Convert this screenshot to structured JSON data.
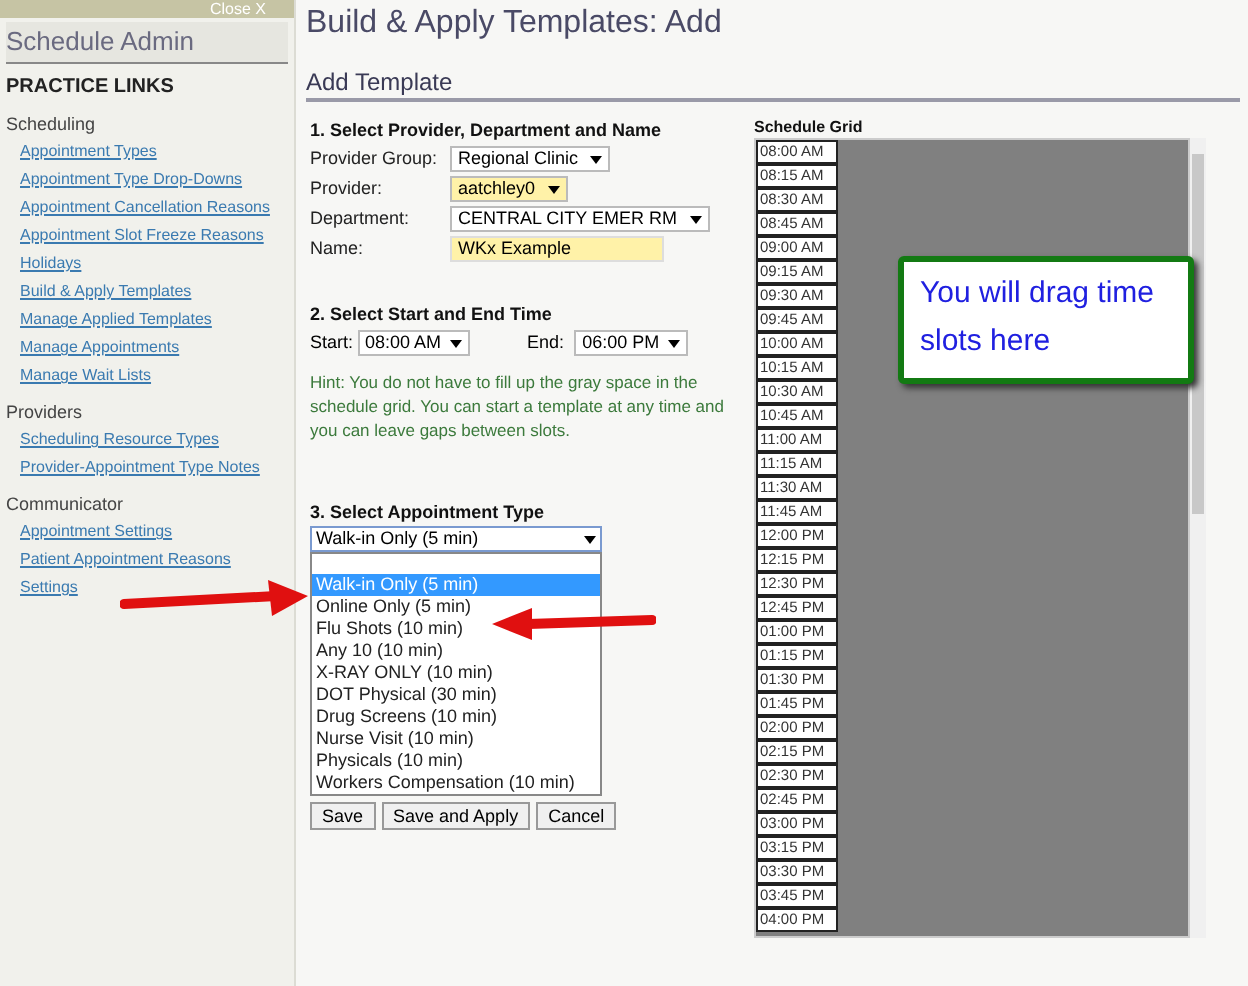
{
  "sidebar": {
    "close_label": "Close X",
    "title": "Schedule Admin",
    "heading": "PRACTICE LINKS",
    "groups": [
      {
        "label": "Scheduling",
        "links": [
          "Appointment Types",
          "Appointment Type Drop-Downs",
          "Appointment Cancellation Reasons",
          "Appointment Slot Freeze Reasons",
          "Holidays",
          "Build & Apply Templates",
          "Manage Applied Templates",
          "Manage Appointments",
          "Manage Wait Lists"
        ]
      },
      {
        "label": "Providers",
        "links": [
          "Scheduling Resource Types",
          "Provider-Appointment Type Notes"
        ]
      },
      {
        "label": "Communicator",
        "links": [
          "Appointment Settings",
          "Patient Appointment Reasons Settings"
        ]
      }
    ]
  },
  "page_title": "Build & Apply Templates: Add",
  "section_title": "Add Template",
  "step1": {
    "heading": "1. Select Provider, Department and Name",
    "fields": [
      {
        "label": "Provider Group:",
        "value": "Regional Clinic",
        "kind": "select",
        "required": false
      },
      {
        "label": "Provider:",
        "value": "aatchley0",
        "kind": "select",
        "required": true
      },
      {
        "label": "Department:",
        "value": "CENTRAL CITY EMER RM",
        "kind": "select",
        "required": false
      },
      {
        "label": "Name:",
        "value": "WKx Example",
        "kind": "text",
        "required": true
      }
    ]
  },
  "step2": {
    "heading": "2. Select Start and End Time",
    "start_label": "Start:",
    "start_value": "08:00 AM",
    "end_label": "End:",
    "end_value": "06:00 PM"
  },
  "hint": "Hint: You do not have to fill up the gray space in the schedule grid. You can start a template at any time and you can leave gaps between slots.",
  "step3": {
    "heading": "3. Select Appointment Type",
    "value": "Walk-in Only (5 min)",
    "options": [
      {
        "label": "Walk-in Only (5 min)",
        "selected": true
      },
      {
        "label": "Online Only (5 min)",
        "selected": false
      },
      {
        "label": "Flu Shots (10 min)",
        "selected": false
      },
      {
        "label": "Any 10 (10 min)",
        "selected": false
      },
      {
        "label": "X-RAY ONLY (10 min)",
        "selected": false
      },
      {
        "label": "DOT Physical (30 min)",
        "selected": false
      },
      {
        "label": "Drug Screens (10 min)",
        "selected": false
      },
      {
        "label": "Nurse Visit (10 min)",
        "selected": false
      },
      {
        "label": "Physicals (10 min)",
        "selected": false
      },
      {
        "label": "Workers Compensation (10 min)",
        "selected": false
      }
    ]
  },
  "buttons": [
    "Save",
    "Save and Apply",
    "Cancel"
  ],
  "grid": {
    "title": "Schedule Grid",
    "callout": "You will drag time slots here",
    "slots": [
      "08:00 AM",
      "08:15 AM",
      "08:30 AM",
      "08:45 AM",
      "09:00 AM",
      "09:15 AM",
      "09:30 AM",
      "09:45 AM",
      "10:00 AM",
      "10:15 AM",
      "10:30 AM",
      "10:45 AM",
      "11:00 AM",
      "11:15 AM",
      "11:30 AM",
      "11:45 AM",
      "12:00 PM",
      "12:15 PM",
      "12:30 PM",
      "12:45 PM",
      "01:00 PM",
      "01:15 PM",
      "01:30 PM",
      "01:45 PM",
      "02:00 PM",
      "02:15 PM",
      "02:30 PM",
      "02:45 PM",
      "03:00 PM",
      "03:15 PM",
      "03:30 PM",
      "03:45 PM",
      "04:00 PM"
    ]
  }
}
